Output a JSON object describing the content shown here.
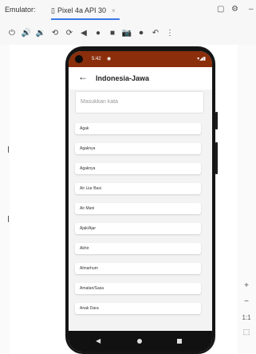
{
  "emulator": {
    "label": "Emulator:",
    "device_tab": "Pixel 4a API 30",
    "tab_close": "×",
    "zoom_in": "+",
    "zoom_out": "−",
    "zoom_actual": "1:1"
  },
  "status_bar": {
    "time": "5:42"
  },
  "app_bar": {
    "title": "Indonesia-Jawa"
  },
  "search": {
    "placeholder": "Masukkan kata",
    "value": ""
  },
  "words": [
    "Agak",
    "Agaknya",
    "Agaknya",
    "Air Liur Basi",
    "Air Mani",
    "Ajak/Ajar",
    "Akhir",
    "Almarhum",
    "Amatan/Sasa",
    "Anak Dara"
  ],
  "colors": {
    "status_bar": "#8a2e0c",
    "accent": "#3b78e7"
  }
}
